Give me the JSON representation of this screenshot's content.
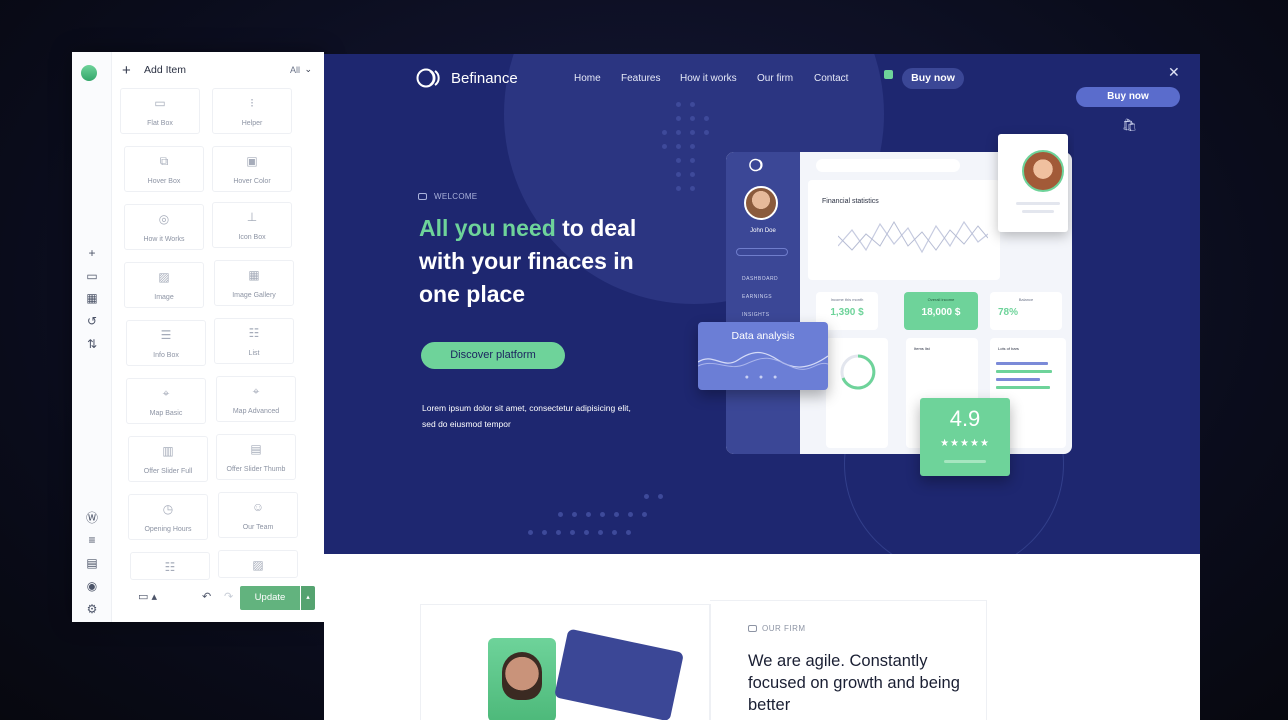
{
  "builder": {
    "header": {
      "title": "Add Item",
      "filter": "All"
    },
    "tiles": [
      {
        "label": "Flat Box",
        "icon": "flat-box-icon"
      },
      {
        "label": "Helper",
        "icon": "helper-icon"
      },
      {
        "label": "Hover Box",
        "icon": "hover-box-icon"
      },
      {
        "label": "Hover Color",
        "icon": "hover-color-icon"
      },
      {
        "label": "How it Works",
        "icon": "how-it-works-icon"
      },
      {
        "label": "Icon Box",
        "icon": "icon-box-icon"
      },
      {
        "label": "Image",
        "icon": "image-icon"
      },
      {
        "label": "Image Gallery",
        "icon": "image-gallery-icon"
      },
      {
        "label": "Info Box",
        "icon": "info-box-icon"
      },
      {
        "label": "List",
        "icon": "list-icon"
      },
      {
        "label": "Map Basic",
        "icon": "map-basic-icon"
      },
      {
        "label": "Map Advanced",
        "icon": "map-advanced-icon"
      },
      {
        "label": "Offer Slider Full",
        "icon": "offer-slider-full-icon"
      },
      {
        "label": "Offer Slider Thumb",
        "icon": "offer-slider-thumb-icon"
      },
      {
        "label": "Opening Hours",
        "icon": "clock-icon"
      },
      {
        "label": "Our Team",
        "icon": "team-icon"
      },
      {
        "label": "",
        "icon": "list-icon"
      },
      {
        "label": "",
        "icon": "image-icon"
      }
    ],
    "footer": {
      "update_label": "Update"
    }
  },
  "site": {
    "brand": "Befinance",
    "nav": [
      "Home",
      "Features",
      "How it works",
      "Our firm",
      "Contact"
    ],
    "buy_label": "Buy now",
    "side_buy_label": "Buy now",
    "welcome": "WELCOME",
    "headline_highlight": "All you need",
    "headline_rest": " to deal with your finaces in one place",
    "cta": "Discover platform",
    "lorem": "Lorem ipsum dolor sit amet, consectetur adipisicing elit, sed do eiusmod tempor"
  },
  "dashboard": {
    "user": "John Doe",
    "menu": [
      "DASHBOARD",
      "EARNINGS",
      "INSIGHTS"
    ],
    "stats_title": "Financial statistics",
    "kpis": [
      {
        "label": "Income this month",
        "value": "1,390 $"
      },
      {
        "label": "Overall income",
        "value": "18,000 $"
      },
      {
        "label": "Balance",
        "value": "78%"
      }
    ],
    "box_titles": [
      "Items list",
      "Lots of bars"
    ],
    "analysis_title": "Data analysis",
    "rating_value": "4.9",
    "rating_stars": "★★★★★"
  },
  "firm": {
    "eyebrow": "OUR FIRM",
    "title": "We are agile. Constantly focused on growth and being better"
  },
  "colors": {
    "accent": "#6ed39a",
    "navy": "#1e2770",
    "update": "#62b37e"
  }
}
